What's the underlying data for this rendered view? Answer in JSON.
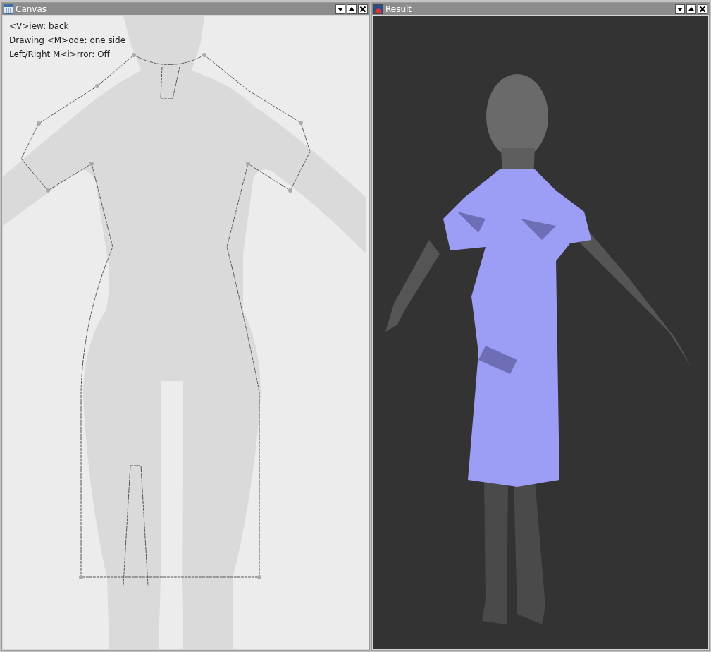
{
  "windows": [
    {
      "kind": "canvas",
      "title": "Canvas",
      "overlay_lines": [
        "<V>iew: back",
        "Drawing <M>ode: one side",
        "Left/Right M<i>rror: Off"
      ]
    },
    {
      "kind": "viewport",
      "title": "Result"
    }
  ]
}
